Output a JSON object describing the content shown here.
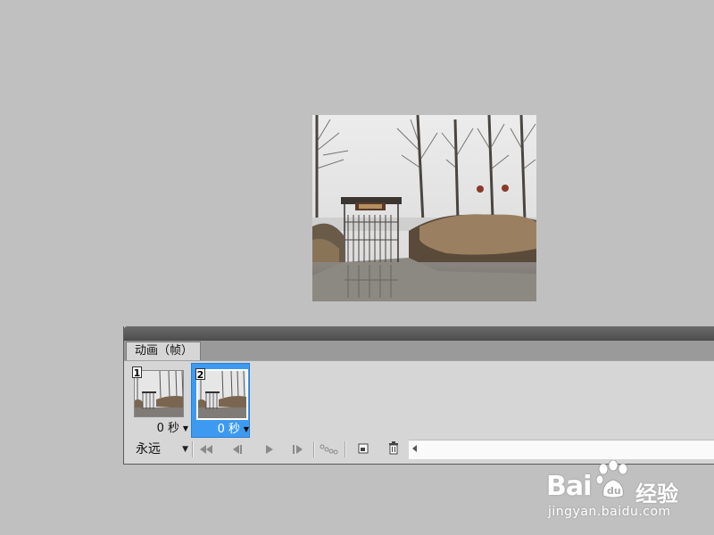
{
  "panel": {
    "tab_label": "动画（帧）"
  },
  "frames": [
    {
      "number": "1",
      "delay": "0 秒",
      "selected": false
    },
    {
      "number": "2",
      "delay": "0 秒",
      "selected": true
    }
  ],
  "toolbar": {
    "loop_value": "永远",
    "buttons": [
      "first-frame-icon",
      "previous-frame-icon",
      "play-icon",
      "next-frame-icon",
      "tween-icon",
      "duplicate-frame-icon",
      "delete-frame-icon"
    ]
  },
  "colors": {
    "selected_frame": "#3d9af0",
    "background": "#c0c0c0",
    "panel": "#d6d6d6"
  },
  "watermark": {
    "logo": "Bai",
    "logo_suffix": "经验",
    "url": "jingyan.baidu.com"
  }
}
